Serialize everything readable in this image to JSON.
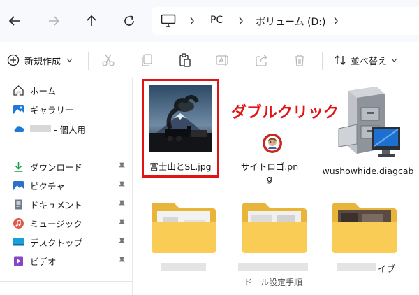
{
  "address_bar": {
    "crumbs": [
      "PC",
      "ボリューム (D:)"
    ]
  },
  "toolbar": {
    "new_label": "新規作成",
    "sort_label": "並べ替え",
    "icons": [
      "cut-icon",
      "copy-icon",
      "paste-icon",
      "rename-icon",
      "share-icon",
      "delete-icon"
    ]
  },
  "sidebar": {
    "items": [
      {
        "label": "ホーム",
        "icon": "home-icon"
      },
      {
        "label": "ギャラリー",
        "icon": "gallery-icon"
      },
      {
        "label": "- 個人用",
        "icon": "onedrive-icon"
      },
      {
        "label": "ダウンロード",
        "icon": "download-icon",
        "pinned": true
      },
      {
        "label": "ピクチャ",
        "icon": "pictures-icon",
        "pinned": true
      },
      {
        "label": "ドキュメント",
        "icon": "documents-icon",
        "pinned": true
      },
      {
        "label": "ミュージック",
        "icon": "music-icon",
        "pinned": true
      },
      {
        "label": "デスクトップ",
        "icon": "desktop-icon",
        "pinned": true
      },
      {
        "label": "ビデオ",
        "icon": "videos-icon",
        "pinned": true
      }
    ]
  },
  "files": [
    {
      "name": "富士山とSL.jpg",
      "type": "image"
    },
    {
      "name": "サイトロゴ.png",
      "type": "image"
    },
    {
      "name": "wushowhide.diagcab",
      "type": "cabinet"
    }
  ],
  "folder_labels": {
    "third_suffix": "イブ",
    "second_line": "ドール設定手順"
  },
  "annotation": {
    "text": "ダブルクリック",
    "color": "#e11414"
  },
  "colors": {
    "folder": "#f8cc55",
    "folder_dark": "#e8b43a",
    "accent_blue": "#1e7ad6"
  }
}
